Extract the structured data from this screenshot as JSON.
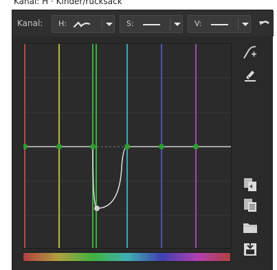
{
  "window": {
    "title_fragment": "Kanal: H · Kinder/rucksack"
  },
  "toolbar": {
    "channel_label": "Kanal:",
    "h_label": "H:",
    "s_label": "S:",
    "v_label": "V:",
    "h_curve_icon": "curve-icon",
    "s_curve_icon": "flat-line-icon",
    "v_curve_icon": "flat-line-icon",
    "undo_icon": "undo-icon"
  },
  "side_tools": {
    "add_point_icon": "curve-add-point-icon",
    "edit_icon": "pencil-edit-icon",
    "copy_icon": "copy-icon",
    "paste_icon": "paste-icon",
    "open_icon": "folder-open-icon",
    "save_icon": "save-icon"
  },
  "graph": {
    "hue_lines": [
      "#c84a4a",
      "#c8c84a",
      "#4ac84a",
      "#4ac8c8",
      "#4a4ac8",
      "#c84ac8"
    ],
    "point_color": "#2e9e2e",
    "curve_color": "#e0e0e0"
  }
}
